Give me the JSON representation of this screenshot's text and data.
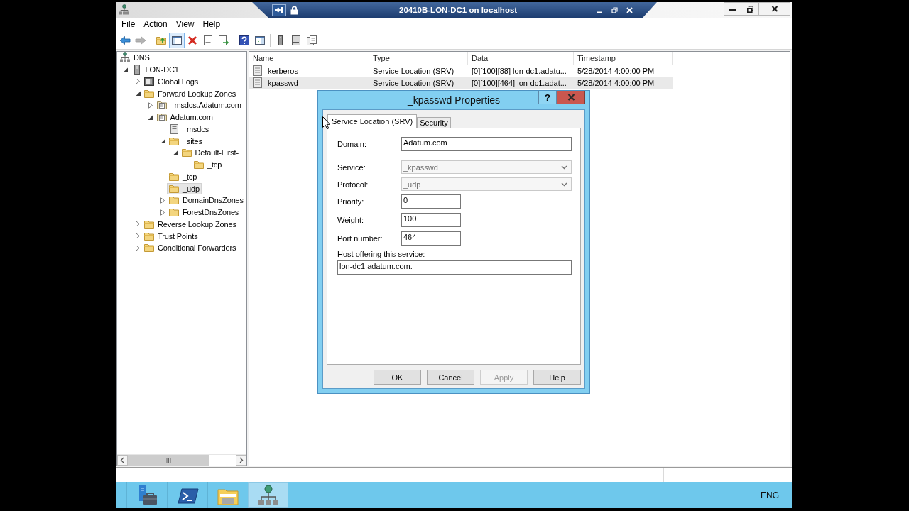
{
  "remote_bar": {
    "title": "20410B-LON-DC1 on localhost"
  },
  "menu": [
    {
      "label": "File"
    },
    {
      "label": "Action"
    },
    {
      "label": "View"
    },
    {
      "label": "Help"
    }
  ],
  "toolbar": [
    [
      {
        "pressed": false,
        "disabled": false
      },
      {
        "pressed": false,
        "disabled": true
      }
    ],
    [
      {
        "pressed": false,
        "disabled": false
      },
      {
        "pressed": true,
        "disabled": false
      },
      {
        "pressed": false,
        "disabled": false
      },
      {
        "pressed": false,
        "disabled": false
      },
      {
        "pressed": false,
        "disabled": false
      }
    ],
    [
      {
        "pressed": false,
        "disabled": false
      },
      {
        "pressed": false,
        "disabled": false
      }
    ],
    [
      {
        "pressed": false,
        "disabled": false
      },
      {
        "pressed": false,
        "disabled": false
      },
      {
        "pressed": false,
        "disabled": false
      }
    ]
  ],
  "tree": [
    {
      "label": "DNS",
      "kind": "dns",
      "selected": false,
      "children": [
        {
          "label": "LON-DC1",
          "kind": "server",
          "expanded": true,
          "selected": false,
          "children": [
            {
              "label": "Global Logs",
              "kind": "logs",
              "expanded": false,
              "selected": false
            },
            {
              "label": "Forward Lookup Zones",
              "kind": "folder",
              "expanded": true,
              "selected": false,
              "children": [
                {
                  "label": "_msdcs.Adatum.com",
                  "kind": "zone",
                  "expanded": false,
                  "selected": false
                },
                {
                  "label": "Adatum.com",
                  "kind": "zone",
                  "expanded": true,
                  "selected": false,
                  "children": [
                    {
                      "label": "_msdcs",
                      "kind": "delegation",
                      "selected": false
                    },
                    {
                      "label": "_sites",
                      "kind": "folder",
                      "expanded": true,
                      "selected": false,
                      "children": [
                        {
                          "label": "Default-First-",
                          "kind": "folder",
                          "expanded": true,
                          "selected": false,
                          "children": [
                            {
                              "label": "_tcp",
                              "kind": "folder",
                              "selected": false
                            }
                          ]
                        }
                      ]
                    },
                    {
                      "label": "_tcp",
                      "kind": "folder",
                      "selected": false
                    },
                    {
                      "label": "_udp",
                      "kind": "folder",
                      "selected": true
                    },
                    {
                      "label": "DomainDnsZones",
                      "kind": "folder",
                      "expanded": false,
                      "selected": false
                    },
                    {
                      "label": "ForestDnsZones",
                      "kind": "folder",
                      "expanded": false,
                      "selected": false
                    }
                  ]
                }
              ]
            },
            {
              "label": "Reverse Lookup Zones",
              "kind": "folder",
              "expanded": false,
              "selected": false
            },
            {
              "label": "Trust Points",
              "kind": "folder",
              "expanded": false,
              "selected": false
            },
            {
              "label": "Conditional Forwarders",
              "kind": "folder",
              "expanded": false,
              "selected": false
            }
          ]
        }
      ]
    }
  ],
  "list": {
    "columns": [
      "Name",
      "Type",
      "Data",
      "Timestamp"
    ],
    "rows": [
      {
        "cells": [
          "_kerberos",
          "Service Location (SRV)",
          "[0][100][88] lon-dc1.adatu...",
          "5/28/2014 4:00:00 PM"
        ],
        "selected": false
      },
      {
        "cells": [
          "_kpasswd",
          "Service Location (SRV)",
          "[0][100][464] lon-dc1.adat...",
          "5/28/2014 4:00:00 PM"
        ],
        "selected": true
      }
    ]
  },
  "dialog": {
    "title": "_kpasswd Properties",
    "help_button": {
      "label": "?"
    },
    "tabs": [
      {
        "label": "Service Location (SRV)",
        "selected": true
      },
      {
        "label": "Security",
        "selected": false
      }
    ],
    "fields": [
      {
        "kind": "text",
        "label": "Domain:",
        "value": "Adatum.com",
        "disabled": false
      },
      {
        "kind": "dropdown",
        "label": "Service:",
        "value": "_kpasswd",
        "disabled": true
      },
      {
        "kind": "dropdown",
        "label": "Protocol:",
        "value": "_udp",
        "disabled": true
      },
      {
        "kind": "short",
        "label": "Priority:",
        "value": "0",
        "disabled": false
      },
      {
        "kind": "short",
        "label": "Weight:",
        "value": "100",
        "disabled": false
      },
      {
        "kind": "short",
        "label": "Port number:",
        "value": "464",
        "disabled": false
      },
      {
        "kind": "stacked",
        "label": "Host offering this service:",
        "value": "lon-dc1.adatum.com.",
        "disabled": false
      }
    ],
    "buttons": [
      {
        "label": "OK",
        "disabled": false
      },
      {
        "label": "Cancel",
        "disabled": false
      },
      {
        "label": "Apply",
        "disabled": true
      },
      {
        "label": "Help",
        "disabled": false
      }
    ]
  },
  "taskbar": {
    "apps": [
      {
        "selected": false
      },
      {
        "selected": false
      },
      {
        "selected": false
      },
      {
        "selected": true
      }
    ],
    "language": "ENG"
  }
}
